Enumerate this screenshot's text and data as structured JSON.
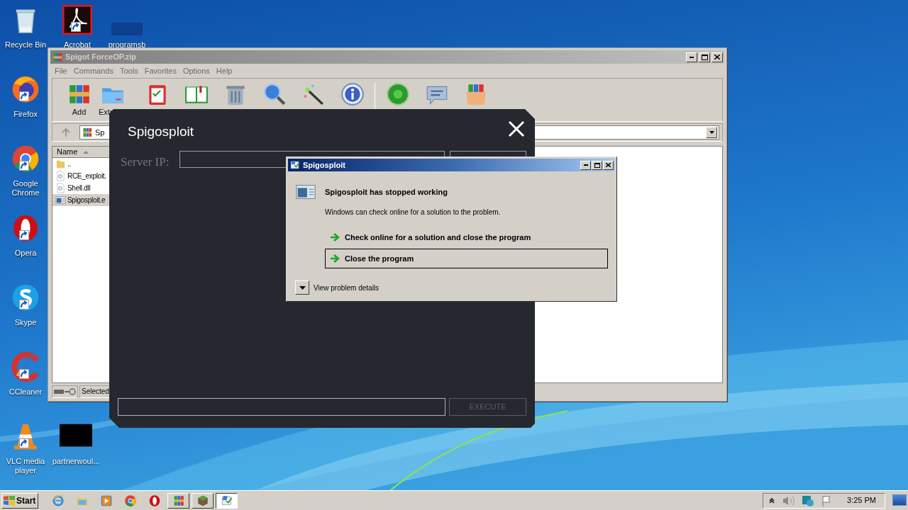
{
  "desktop_icons": [
    {
      "kind": "recycle",
      "label": "Recycle Bin",
      "shortcut": false
    },
    {
      "kind": "acrobat",
      "label": "Acrobat",
      "shortcut": true
    },
    {
      "kind": "blank",
      "label": "programsb",
      "shortcut": false
    },
    {
      "kind": "firefox",
      "label": "Firefox",
      "shortcut": true
    },
    {
      "kind": "chrome",
      "label": "Google Chrome",
      "shortcut": true
    },
    {
      "kind": "opera",
      "label": "Opera",
      "shortcut": true
    },
    {
      "kind": "skype",
      "label": "Skype",
      "shortcut": true
    },
    {
      "kind": "ccleaner",
      "label": "CCleaner",
      "shortcut": true
    },
    {
      "kind": "vlc",
      "label": "VLC media player",
      "shortcut": true
    },
    {
      "kind": "black",
      "label": "partnerwoul...",
      "shortcut": false
    }
  ],
  "archive_window": {
    "title": "Spigot ForceOP.zip",
    "menu": [
      "File",
      "Commands",
      "Tools",
      "Favorites",
      "Options",
      "Help"
    ],
    "toolbar": [
      {
        "kind": "add",
        "label": "Add"
      },
      {
        "kind": "extract",
        "label": "Extr"
      },
      {
        "kind": "test"
      },
      {
        "kind": "view"
      },
      {
        "kind": "delete"
      },
      {
        "kind": "find"
      },
      {
        "kind": "wizard"
      },
      {
        "kind": "info"
      },
      {
        "kind": "virus"
      },
      {
        "kind": "comment"
      },
      {
        "kind": "sfx"
      }
    ],
    "path_field": {
      "value": "Sp"
    },
    "column": "Name",
    "files": [
      {
        "kind": "folder",
        "name": "..",
        "selected": false
      },
      {
        "kind": "dll",
        "name": "RCE_exploit.",
        "selected": false
      },
      {
        "kind": "dll",
        "name": "Shell.dll",
        "selected": false
      },
      {
        "kind": "exe",
        "name": "Spigosploit.e",
        "selected": true
      }
    ],
    "status": "Selected"
  },
  "app_window": {
    "title": "Spigosploit",
    "server_label": "Server IP:",
    "execute": {
      "label": "EXECUTE",
      "disabled": true
    }
  },
  "error_dialog": {
    "title": "Spigosploit",
    "heading": "Spigosploit has stopped working",
    "message": "Windows can check online for a solution to the problem.",
    "options": [
      {
        "label": "Check online for a solution and close the program",
        "selected": false
      },
      {
        "label": "Close the program",
        "selected": true
      }
    ],
    "details": {
      "label": "View problem details",
      "expanded": false
    }
  },
  "taskbar": {
    "start": "Start",
    "quick_launch": [
      {
        "kind": "ie"
      },
      {
        "kind": "explorer"
      },
      {
        "kind": "media"
      },
      {
        "kind": "chrome"
      },
      {
        "kind": "opera"
      }
    ],
    "tasks": [
      {
        "kind": "winrar",
        "selected": false
      },
      {
        "kind": "block",
        "selected": false
      },
      {
        "kind": "report",
        "selected": true
      }
    ],
    "clock": "3:25 PM"
  }
}
